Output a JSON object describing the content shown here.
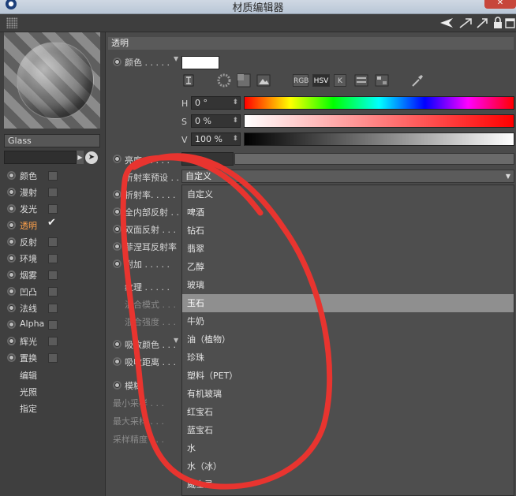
{
  "window": {
    "title": "材质编辑器",
    "close_glyph": "✕"
  },
  "toolbar": {
    "icons": [
      "arrow-left-icon",
      "arrow-up-right-icon",
      "lock-icon",
      "new-window-icon"
    ]
  },
  "left_panel": {
    "material_name": "Glass",
    "channels": [
      {
        "label": "颜色",
        "checked": false,
        "active": false
      },
      {
        "label": "漫射",
        "checked": false,
        "active": false
      },
      {
        "label": "发光",
        "checked": false,
        "active": false
      },
      {
        "label": "透明",
        "checked": true,
        "active": true
      },
      {
        "label": "反射",
        "checked": false,
        "active": false
      },
      {
        "label": "环境",
        "checked": false,
        "active": false
      },
      {
        "label": "烟雾",
        "checked": false,
        "active": false
      },
      {
        "label": "凹凸",
        "checked": false,
        "active": false
      },
      {
        "label": "法线",
        "checked": false,
        "active": false
      },
      {
        "label": "Alpha",
        "checked": false,
        "active": false
      },
      {
        "label": "辉光",
        "checked": false,
        "active": false
      },
      {
        "label": "置换",
        "checked": false,
        "active": false
      }
    ],
    "extra_items": [
      "编辑",
      "光照",
      "指定"
    ]
  },
  "panel": {
    "section_title": "透明",
    "color_label": "颜色 . . . . .",
    "color_value": "#ffffff",
    "mode_buttons": [
      "RGB",
      "HSV",
      "K"
    ],
    "active_mode": "HSV",
    "hsv": {
      "h_label": "H",
      "h_value": "0 °",
      "s_label": "S",
      "s_value": "0 %",
      "v_label": "V",
      "v_value": "100 %"
    },
    "brightness_label": "亮度 . . . . .",
    "ior_preset_label": "折射率预设 . .",
    "ior_preset_value": "自定义",
    "ior_label": "折射率. . . . .",
    "total_internal_label": "全内部反射 . .",
    "double_sided_label": "双面反射 . . .",
    "fresnel_label": "菲涅耳反射率",
    "additive_label": "附加 . . . . .",
    "texture_label": "纹理 . . . . .",
    "blend_mode_label": "混合模式 . . .",
    "blend_strength_label": "混合强度 . . .",
    "absorb_color_label": "吸收颜色 . . .",
    "absorb_distance_label": "吸收距离 . . .",
    "blur_label": "模糊",
    "min_samples_label": "最小采样 . . .",
    "max_samples_label": "最大采样 . . .",
    "sample_accuracy_label": "采样精度 . . ."
  },
  "dropdown": {
    "highlighted_index": 6,
    "options": [
      "自定义",
      "啤酒",
      "钻石",
      "翡翠",
      "乙醇",
      "玻璃",
      "玉石",
      "牛奶",
      "油（植物）",
      "珍珠",
      "塑料（PET）",
      "有机玻璃",
      "红宝石",
      "蓝宝石",
      "水",
      "水（冰）",
      "威士忌"
    ]
  },
  "colors": {
    "annotation": "#e8342f",
    "active_channel": "#ffa14a"
  }
}
